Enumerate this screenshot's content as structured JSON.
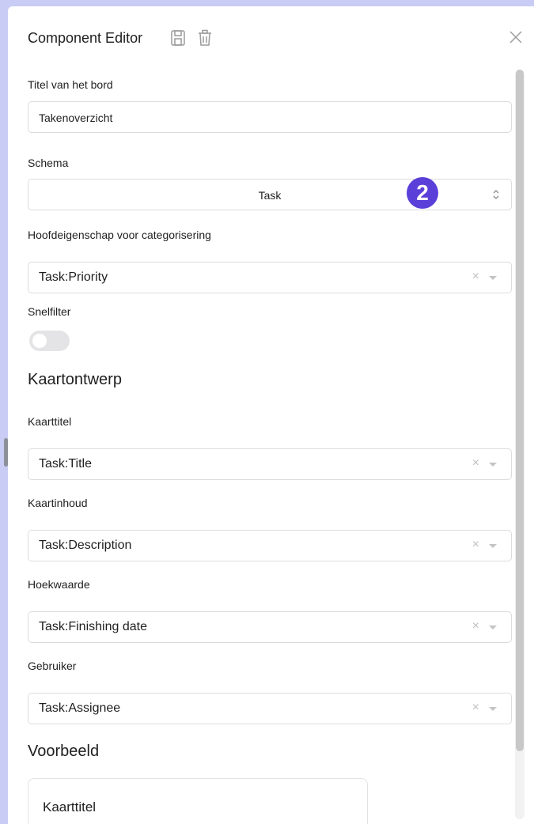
{
  "header": {
    "title": "Component Editor",
    "icons": [
      "save-icon",
      "trash-icon",
      "close-icon"
    ]
  },
  "form": {
    "board_title_label": "Titel van het bord",
    "board_title_value": "Takenoverzicht",
    "schema_label": "Schema",
    "schema_value": "Task",
    "category_label": "Hoofdeigenschap voor categorisering",
    "category_value": "Task:Priority",
    "quickfilter_label": "Snelfilter",
    "quickfilter_on": false
  },
  "card_design": {
    "heading": "Kaartontwerp",
    "fields": [
      {
        "label": "Kaarttitel",
        "value": "Task:Title"
      },
      {
        "label": "Kaartinhoud",
        "value": "Task:Description"
      },
      {
        "label": "Hoekwaarde",
        "value": "Task:Finishing date"
      },
      {
        "label": "Gebruiker",
        "value": "Task:Assignee"
      }
    ]
  },
  "preview": {
    "heading": "Voorbeeld",
    "card_title": "Kaarttitel"
  },
  "annotation": {
    "badge_number": "2",
    "badge_color": "#5b3fd9"
  },
  "clear_glyph": "×"
}
